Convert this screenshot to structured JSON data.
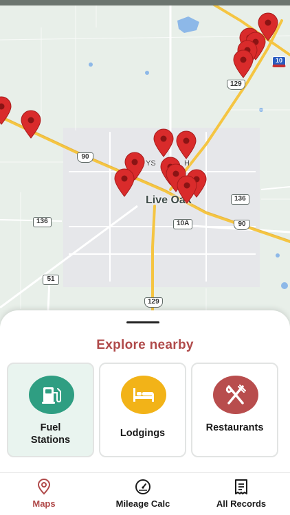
{
  "map": {
    "city_label": "Live Oak",
    "street_fragments": [
      "YS",
      "H"
    ],
    "shields": {
      "us90_west": "90",
      "us129_north": "129",
      "i10": "10",
      "sr136_east": "136",
      "sr136_west": "136",
      "sr10a": "10A",
      "us90_east": "90",
      "sr51": "51",
      "us129_south": "129"
    },
    "pin_color": "#d92b2b",
    "land_color": "#e8efe9",
    "road_color": "#f5c542"
  },
  "sheet": {
    "title": "Explore nearby",
    "title_color": "#b04a4a",
    "cards": [
      {
        "label_line1": "Fuel",
        "label_line2": "Stations",
        "icon": "fuel-pump-icon",
        "color": "#2f9e82",
        "selected": true
      },
      {
        "label": "Lodgings",
        "icon": "bed-icon",
        "color": "#f2b318"
      },
      {
        "label": "Restaurants",
        "icon": "fork-knife-icon",
        "color": "#b84d4d"
      }
    ]
  },
  "nav": {
    "items": [
      {
        "label": "Maps",
        "icon": "map-pin-icon",
        "active": true
      },
      {
        "label": "Mileage Calc",
        "icon": "speedometer-icon"
      },
      {
        "label": "All Records",
        "icon": "receipt-icon"
      }
    ],
    "active_color": "#b04a4a"
  }
}
